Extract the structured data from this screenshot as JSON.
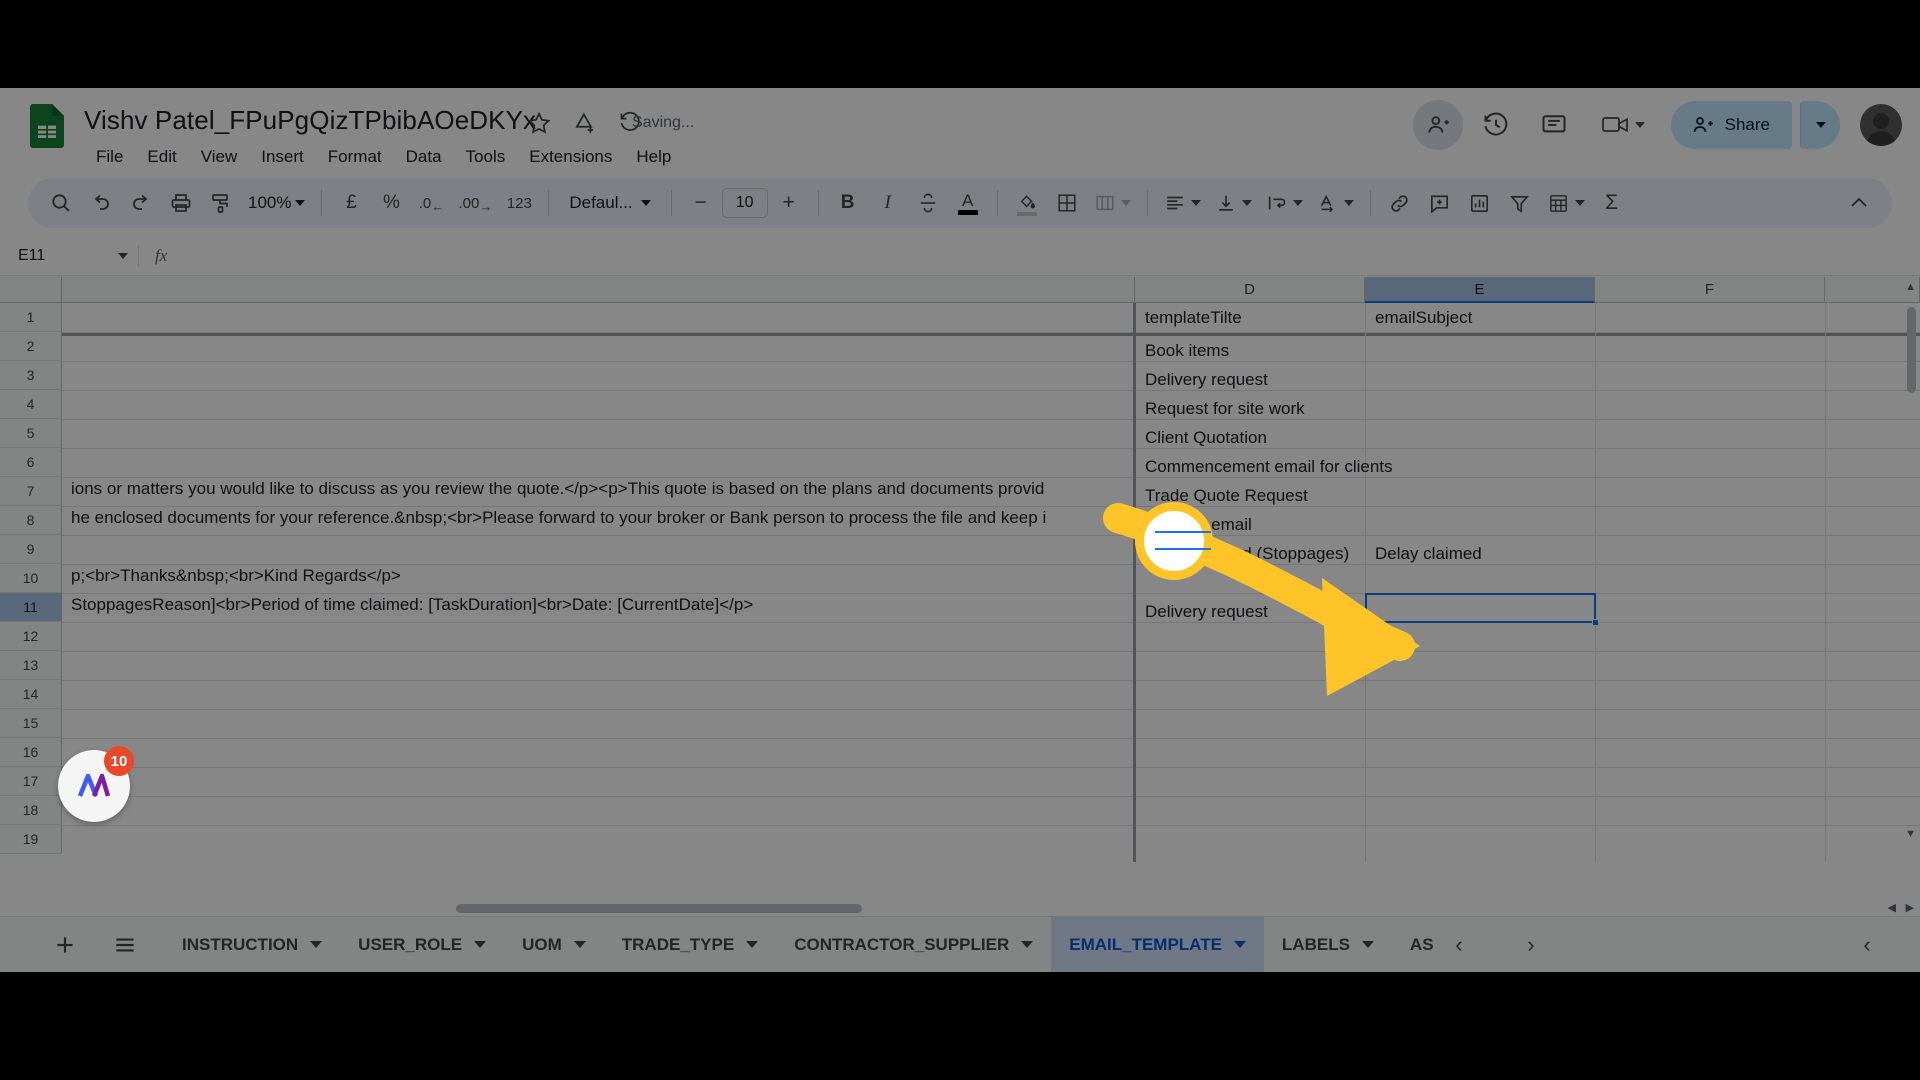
{
  "app": {
    "name": "Google Sheets"
  },
  "titlebar": {
    "doc_title": "Vishv Patel_FPuPgQizTPbibAOeDKYx",
    "save_status": "Saving...",
    "star_icon": "star-icon",
    "move_icon": "move-to-drive-icon",
    "history_icon": "version-history-icon",
    "menus": [
      "File",
      "Edit",
      "View",
      "Insert",
      "Format",
      "Data",
      "Tools",
      "Extensions",
      "Help"
    ],
    "share_label": "Share",
    "present_icon": "presence-icon",
    "clock_icon": "history-clock-icon",
    "comment_icon": "comment-icon",
    "meet_icon": "meet-camera-icon"
  },
  "toolbar": {
    "search_icon": "search-icon",
    "undo_icon": "undo-icon",
    "redo_icon": "redo-icon",
    "print_icon": "print-icon",
    "paint_icon": "paint-format-icon",
    "zoom_value": "100%",
    "currency_label": "£",
    "percent_label": "%",
    "dec_decrease_label": ".0",
    "dec_increase_label": ".00",
    "more_formats_label": "123",
    "font_name": "Defaul...",
    "font_minus": "−",
    "font_size": "10",
    "font_plus": "+",
    "bold_label": "B",
    "italic_label": "I",
    "strike_label": "S",
    "text_color_label": "A",
    "fill_icon": "fill-color-icon",
    "borders_icon": "borders-icon",
    "merge_icon": "merge-cells-icon",
    "halign_icon": "horizontal-align-icon",
    "valign_icon": "vertical-align-icon",
    "wrap_icon": "text-wrap-icon",
    "rotate_icon": "text-rotation-icon",
    "link_icon": "insert-link-icon",
    "comment_icon": "insert-comment-icon",
    "chart_icon": "insert-chart-icon",
    "filter_icon": "filter-icon",
    "functions_icon": "functions-icon",
    "sigma_label": "Σ",
    "collapse_icon": "chevron-up-icon"
  },
  "formula_bar": {
    "name_box": "E11",
    "fx_label": "fx",
    "formula_value": ""
  },
  "grid": {
    "columns": [
      "D",
      "E",
      "F"
    ],
    "selected_column": "E",
    "selected_row": "11",
    "selected_cell": "E11",
    "rows": [
      "1",
      "2",
      "3",
      "4",
      "5",
      "6",
      "7",
      "8",
      "9",
      "10",
      "11",
      "12",
      "13",
      "14",
      "15",
      "16",
      "17",
      "18",
      "19"
    ],
    "cells_c": {
      "5": "ions or matters you would like to discuss as you review the quote.</p><p>This quote is based on the plans and documents provid",
      "6": "he enclosed documents for your reference.&nbsp;<br>Please forward to your broker or Bank person to process the file and keep i",
      "8": "p;<br>Thanks&nbsp;<br>Kind Regards</p>",
      "9": "StoppagesReason]<br>Period of time claimed: [TaskDuration]<br>Date: [CurrentDate]</p>"
    },
    "cells_d": {
      "1": "templateTilte",
      "2": "Book items",
      "3": "Delivery request",
      "4": "Request for site work",
      "5": "Client Quotation",
      "6": "Commencement email for clients",
      "7": "Trade Quote Request",
      "8": "Booking email",
      "9": "Delay claimed (Stoppages)",
      "11": "Delivery request"
    },
    "cells_e": {
      "1": "emailSubject",
      "9": "Delay claimed",
      "11": ""
    }
  },
  "sheet_tabs": {
    "add_icon": "add-sheet-icon",
    "all_sheets_icon": "all-sheets-icon",
    "tabs": [
      {
        "label": "INSTRUCTION",
        "active": false
      },
      {
        "label": "USER_ROLE",
        "active": false
      },
      {
        "label": "UOM",
        "active": false
      },
      {
        "label": "TRADE_TYPE",
        "active": false
      },
      {
        "label": "CONTRACTOR_SUPPLIER",
        "active": false
      },
      {
        "label": "EMAIL_TEMPLATE",
        "active": true
      },
      {
        "label": "LABELS",
        "active": false
      },
      {
        "label": "AS",
        "active": false
      }
    ],
    "prev_icon": "chevron-left-icon",
    "next_icon": "chevron-right-icon",
    "panel_icon": "side-panel-icon"
  },
  "annotation": {
    "arrow_color": "#FFC528",
    "target_cell": "E11",
    "ring_label": ""
  },
  "widget": {
    "name": "mixpanel-widget",
    "badge_count": "10"
  },
  "colors": {
    "accent": "#1a73e8",
    "sheets_green": "#188038",
    "share_bg": "#c2e7ff",
    "active_tab_bg": "#d3e3fd",
    "annotation_yellow": "#FFC528"
  }
}
